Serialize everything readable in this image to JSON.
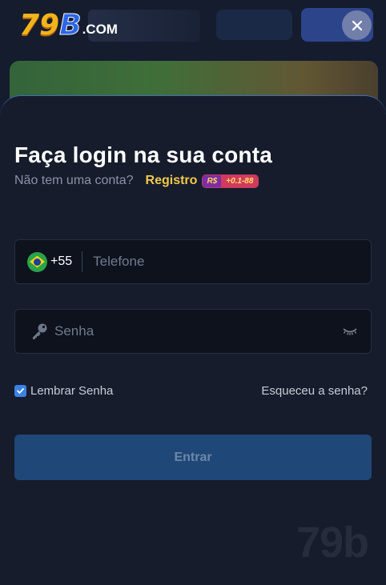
{
  "background": {
    "logo": {
      "main": "79",
      "accent": "B",
      "suffix": ".COM"
    }
  },
  "close": {
    "icon": "close-icon"
  },
  "login": {
    "title": "Faça login na sua conta",
    "subtitle": "Não tem uma conta?",
    "register_label": "Registro",
    "bonus": {
      "currency": "R$",
      "value": "+0.1-88"
    }
  },
  "phone": {
    "country_code": "+55",
    "placeholder": "Telefone",
    "value": "",
    "flag": "brazil-flag-icon"
  },
  "password": {
    "placeholder": "Senha",
    "value": "",
    "icon": "key-icon",
    "toggle_icon": "eye-closed-icon"
  },
  "remember": {
    "label": "Lembrar Senha",
    "checked": true
  },
  "forgot_label": "Esqueceu a senha?",
  "submit_label": "Entrar",
  "watermark": "79b",
  "colors": {
    "accent": "#3b82e6",
    "register": "#f2c94c",
    "button": "#1f4778",
    "panel": "#161c2b"
  }
}
